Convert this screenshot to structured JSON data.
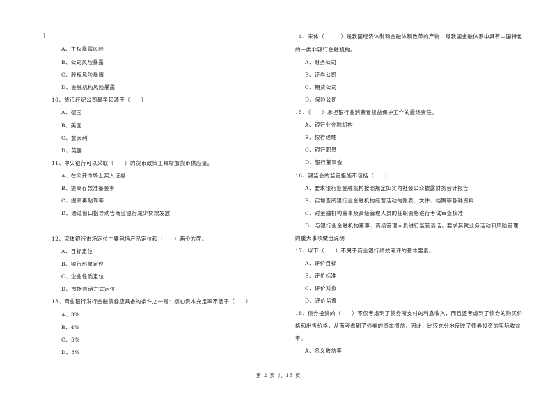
{
  "left_column": {
    "continuation": "）",
    "q9_options": [
      "A、主权暴露风险",
      "B、公司风险暴露",
      "C、股权风险暴露",
      "D、金融机构风险暴露"
    ],
    "q10": {
      "stem": "10、货币经纪公司最早起源于（　　）",
      "options": [
        "A、德国",
        "B、美国",
        "C、意大利",
        "D、英国"
      ]
    },
    "q11": {
      "stem": "11、中央银行可以采取（　　）的货币政策工具增加货币供应量。",
      "options": [
        "A、在公开市场上买入证券",
        "B、提高存款准备金率",
        "C、提高再贴现率",
        "D、通过窗口指导劝告商业银行减少贷款发放"
      ]
    },
    "q12": {
      "stem": "12、宋体银行市场定位主要包括产品定位和（　　）两个方面。",
      "options": [
        "A、目标定位",
        "B、银行形象定位",
        "C、企业性质定位",
        "D、市场营销方式定位"
      ]
    },
    "q13": {
      "stem": "13、商业银行发行金融债券应具备的条件之一是：核心资本充足率不低于（　　）",
      "options": [
        "A、3%",
        "B、4%",
        "C、5%",
        "D、8%"
      ]
    }
  },
  "right_column": {
    "q14": {
      "stem_line1": "14、宋体（　　　）是我国经济体制和金融体制改革的产物，是我国金融体系中具有中国特色",
      "stem_line2": "的一类非银行金融机构。",
      "options": [
        "A、财务公司",
        "B、证券公司",
        "C、期货公司",
        "D、保险公司"
      ]
    },
    "q15": {
      "stem": "15、（　　）承担银行业消费者权益保护工作的最终责任。",
      "options": [
        "A、银行业金融机构",
        "B、银行经理",
        "C、银行职员",
        "D、银行董事会"
      ]
    },
    "q16": {
      "stem": "16、银监会的监管措施不包括（　　）",
      "options": [
        "A、要求银行业金融机构按照规定如实向社会公众披露财务会计报告",
        "B、实地查阅银行业金融机构经营活动的账表、文件、档案等各种资料",
        "C、对金融机构董事及高级管理人员的任职资格进行考试审查核准",
        "D、与银行业金融机构董事、高级管理人员进行监管谈话，要求其就业务活动和风险管理"
      ],
      "option_d_line2": "的重大事项做出说明"
    },
    "q17": {
      "stem": "17、以下（　　）不属于商业银行绩效考评的基本要素。",
      "options": [
        "A、评价目标",
        "B、评价标准",
        "C、评价对象",
        "D、评价监督"
      ]
    },
    "q18": {
      "stem_line1": "18、债券投资的（　　）不仅考虑到了债券所支付的利息收入，而且还考虑到了债券的购买价",
      "stem_line2": "格和出售价格，从而考虑到了债券的资本损益，因此，比较充分地反映了债券投资的实际收益",
      "stem_line3": "率。",
      "options": [
        "A、名义收益率"
      ]
    }
  },
  "footer": {
    "page_label": "第 2 页 共 18 页"
  }
}
